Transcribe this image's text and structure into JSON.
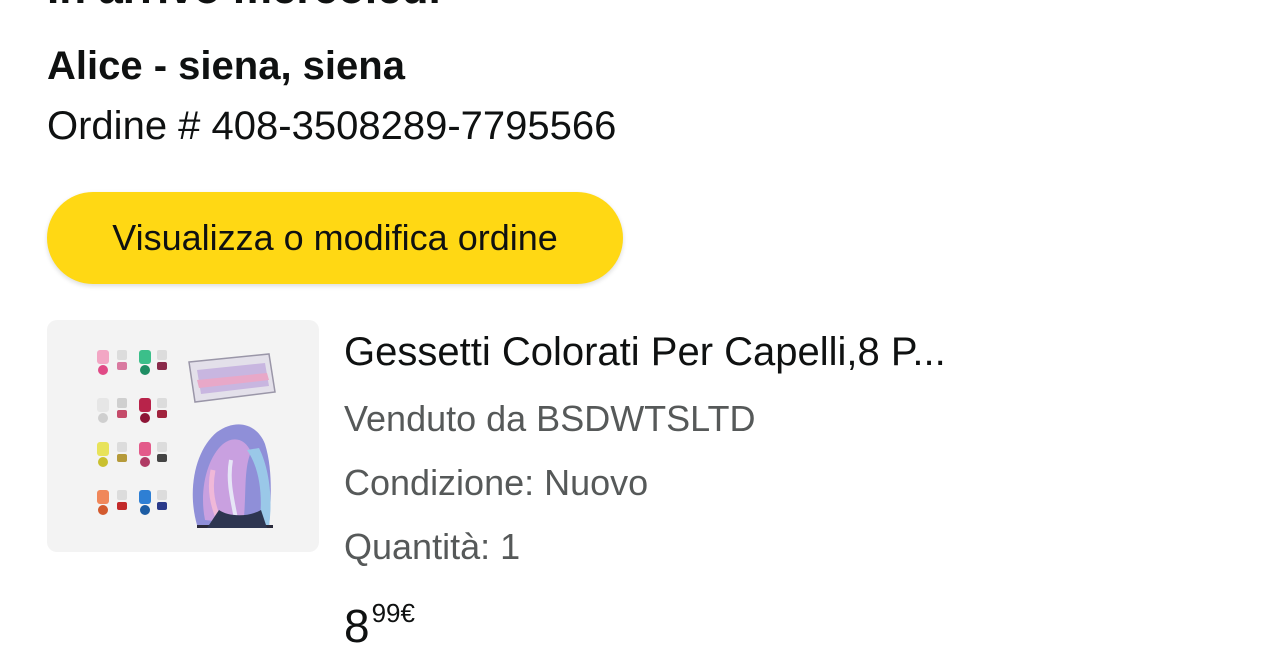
{
  "order": {
    "status_heading": "In arrivo mercoledì",
    "recipient": "Alice - siena, siena",
    "order_number": "Ordine # 408-3508289-7795566",
    "view_button_label": "Visualizza o modifica ordine"
  },
  "product": {
    "title": "Gessetti Colorati Per Capelli,8 P...",
    "seller": "Venduto da BSDWTSLTD",
    "condition": "Condizione: Nuovo",
    "quantity": "Quantità: 1",
    "price_whole": "8",
    "price_fraction": "99€"
  },
  "colors": {
    "button": "#ffd814",
    "text": "#0f1111",
    "secondary_text": "#565959"
  }
}
